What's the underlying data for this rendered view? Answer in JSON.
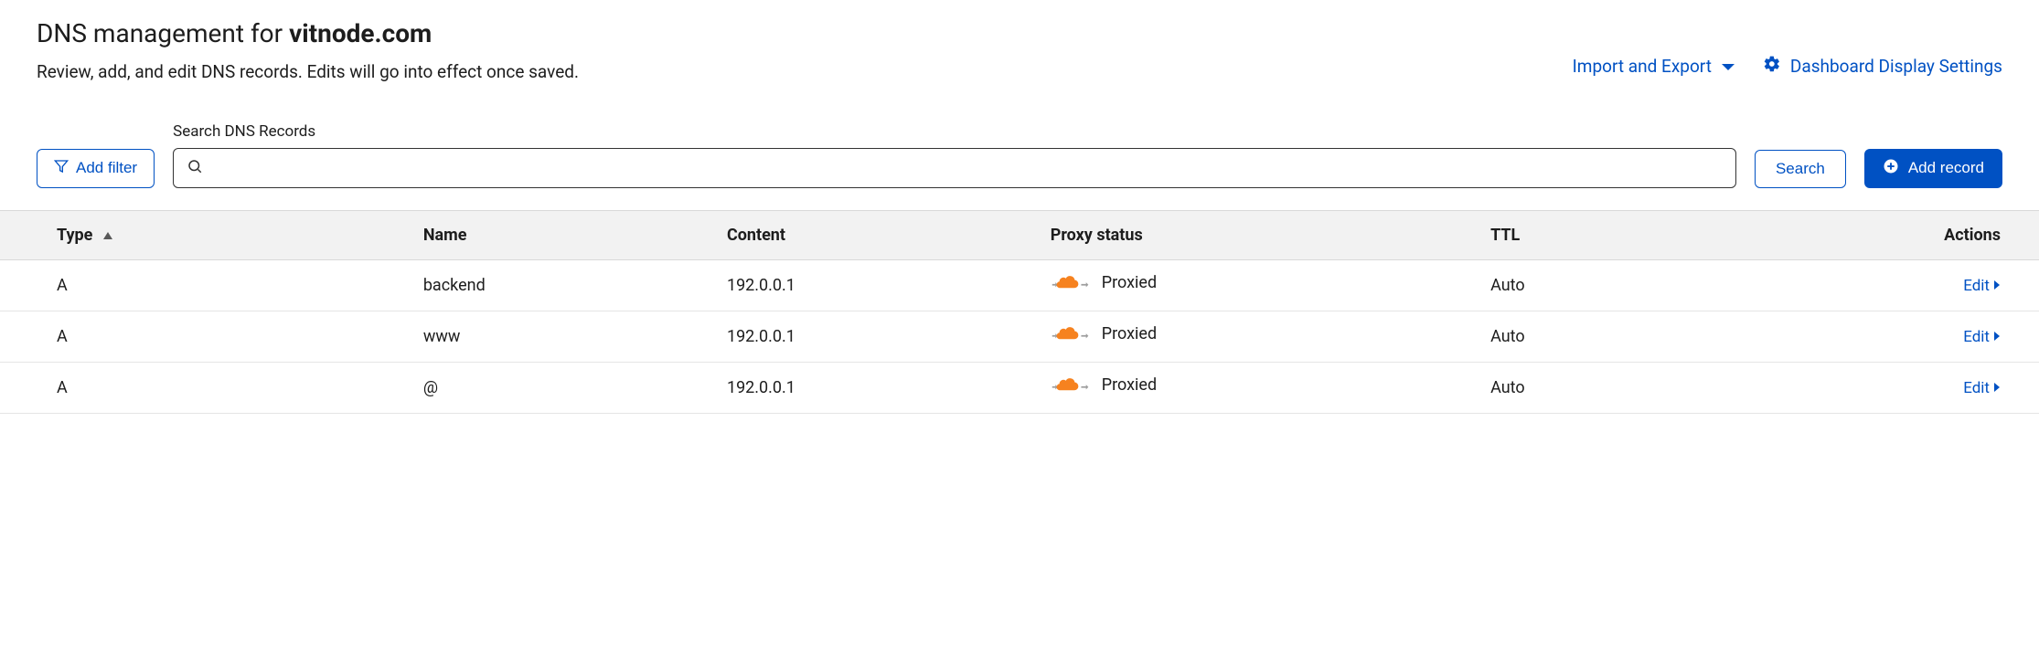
{
  "header": {
    "title_prefix": "DNS management for ",
    "title_domain": "vitnode.com",
    "subtitle": "Review, add, and edit DNS records. Edits will go into effect once saved.",
    "import_export": "Import and Export",
    "display_settings": "Dashboard Display Settings"
  },
  "controls": {
    "add_filter": "Add filter",
    "search_label": "Search DNS Records",
    "search_value": "",
    "search_button": "Search",
    "add_record": "Add record"
  },
  "table": {
    "columns": {
      "type": "Type",
      "name": "Name",
      "content": "Content",
      "proxy": "Proxy status",
      "ttl": "TTL",
      "actions": "Actions"
    },
    "edit_label": "Edit",
    "rows": [
      {
        "type": "A",
        "name": "backend",
        "content": "192.0.0.1",
        "proxy": "Proxied",
        "ttl": "Auto"
      },
      {
        "type": "A",
        "name": "www",
        "content": "192.0.0.1",
        "proxy": "Proxied",
        "ttl": "Auto"
      },
      {
        "type": "A",
        "name": "@",
        "content": "192.0.0.1",
        "proxy": "Proxied",
        "ttl": "Auto"
      }
    ]
  }
}
